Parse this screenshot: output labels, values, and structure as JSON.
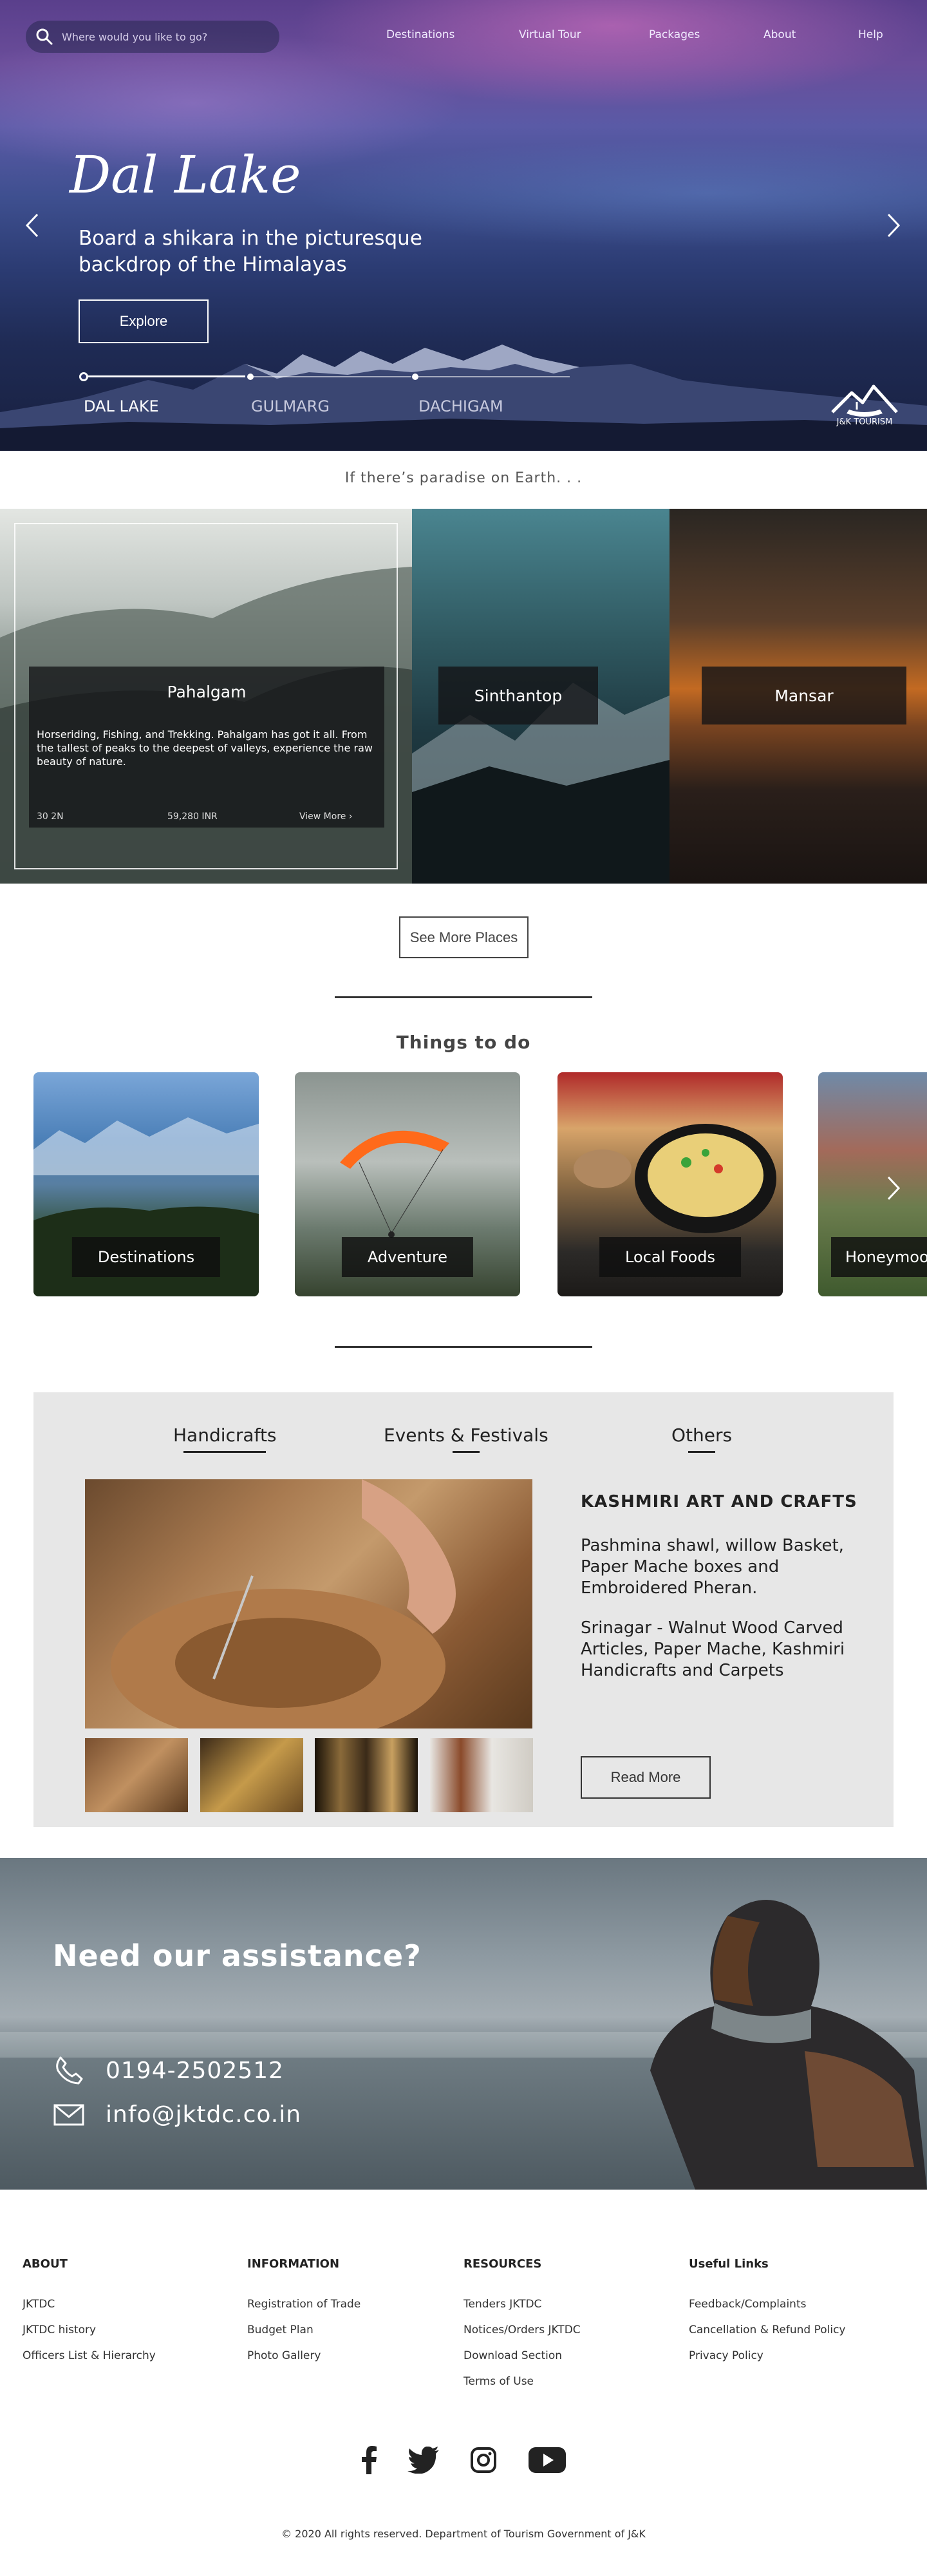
{
  "search": {
    "placeholder": "Where would you like to go?"
  },
  "nav": [
    "Destinations",
    "Virtual Tour",
    "Packages",
    "About",
    "Help"
  ],
  "hero": {
    "title": "Dal Lake",
    "subtitle": "Board a shikara in the picturesque backdrop of the Himalayas",
    "cta": "Explore",
    "slides": [
      "DAL LAKE",
      "GULMARG",
      "DACHIGAM"
    ],
    "logo_text": "J&K TOURISM"
  },
  "tagline": "If there’s paradise on Earth. . .",
  "places": {
    "featured": {
      "name": "Pahalgam",
      "description": "Horseriding, Fishing, and Trekking. Pahalgam has got it all. From the tallest of peaks to the deepest of valleys, experience the raw beauty of nature.",
      "temperature": "30 2N",
      "price": "59,280 INR",
      "more": "View More"
    },
    "others": [
      "Sinthantop",
      "Mansar"
    ],
    "see_more": "See More Places"
  },
  "things_to_do": {
    "title": "Things to do",
    "items": [
      "Destinations",
      "Adventure",
      "Local Foods",
      "Honeymoon"
    ]
  },
  "crafts": {
    "tabs": [
      "Handicrafts",
      "Events & Festivals",
      "Others"
    ],
    "heading": "KASHMIRI ART AND CRAFTS",
    "paragraph1": "Pashmina shawl, willow Basket, Paper Mache boxes and Embroidered Pheran.",
    "paragraph2": "Srinagar - Walnut Wood Carved Articles, Paper Mache, Kashmiri Handicrafts and Carpets",
    "button": "Read More"
  },
  "assistance": {
    "title": "Need our assistance?",
    "phone": "0194-2502512",
    "email": "info@jktdc.co.in"
  },
  "footer": {
    "about": {
      "heading": "ABOUT",
      "links": [
        "JKTDC",
        "JKTDC history",
        "Officers List & Hierarchy"
      ]
    },
    "information": {
      "heading": "INFORMATION",
      "links": [
        "Registration of Trade",
        "Budget Plan",
        "Photo Gallery"
      ]
    },
    "resources": {
      "heading": "RESOURCES",
      "links": [
        "Tenders JKTDC",
        "Notices/Orders JKTDC",
        "Download Section",
        "Terms of Use"
      ]
    },
    "useful": {
      "heading": "Useful Links",
      "links": [
        "Feedback/Complaints",
        "Cancellation & Refund Policy",
        "Privacy Policy"
      ]
    },
    "social_icons": [
      "facebook-icon",
      "twitter-icon",
      "instagram-icon",
      "youtube-icon"
    ],
    "copyright": "© 2020 All rights reserved. Department of Tourism Government of J&K"
  }
}
